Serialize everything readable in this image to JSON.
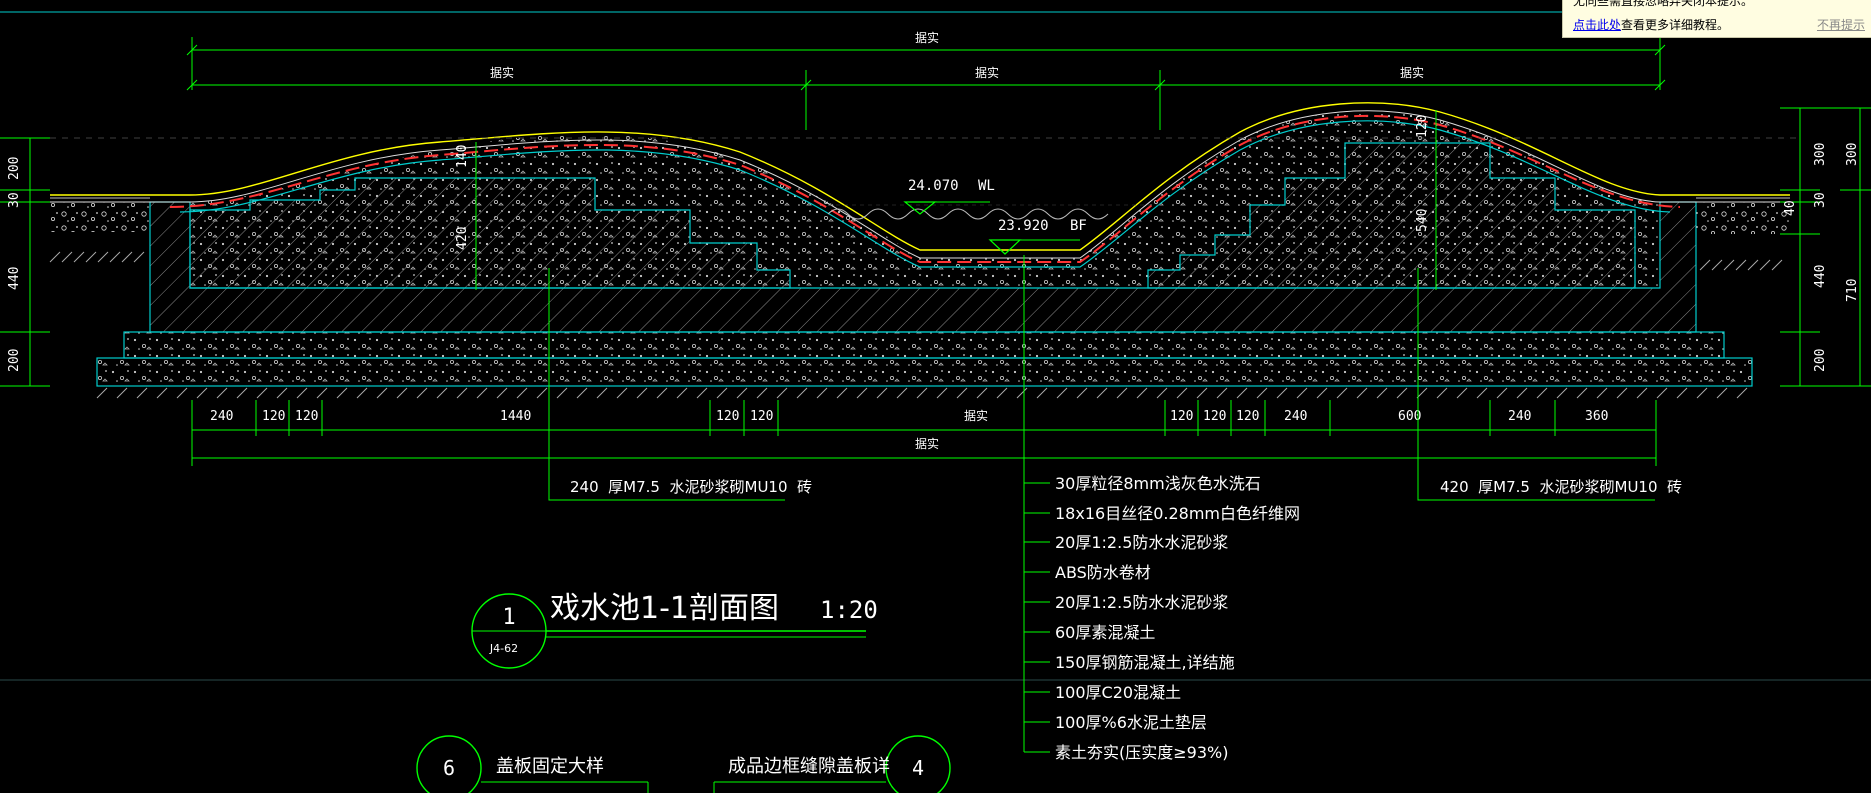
{
  "drawing": {
    "title": "戏水池1-1剖面图",
    "scale": "1:20",
    "section_number": "1",
    "sheet_ref": "J4-62",
    "top_dimension": "据实",
    "top_sub_dimensions": [
      "据实",
      "据实",
      "据实"
    ],
    "water_level": {
      "value": "24.070",
      "tag": "WL"
    },
    "bottom_level": {
      "value": "23.920",
      "tag": "BF"
    },
    "left_mound": {
      "cover": "140",
      "height": "420"
    },
    "right_mound": {
      "cover": "120",
      "height": "540"
    },
    "left_side_dims": [
      "200",
      "30",
      "440",
      "200"
    ],
    "right_side_dims_inner": [
      "300",
      "30",
      "40",
      "440",
      "200"
    ],
    "right_side_dims_outer": [
      "300",
      "710"
    ],
    "bottom_dims": [
      "240",
      "120",
      "120",
      "1440",
      "120",
      "120",
      "据实",
      "120",
      "120",
      "120",
      "240",
      "600",
      "240",
      "360"
    ],
    "bottom_total": "据实",
    "left_note": "240  厚M7.5  水泥砂浆砌MU10  砖",
    "right_note": "420  厚M7.5  水泥砂浆砌MU10  砖",
    "layers": [
      "30厚粒径8mm浅灰色水洗石",
      "18x16目丝径0.28mm白色纤维网",
      "20厚1:2.5防水水泥砂浆",
      "ABS防水卷材",
      "20厚1:2.5防水水泥砂浆",
      "60厚素混凝土",
      "150厚钢筋混凝土,详结施",
      "100厚C20混凝土",
      "100厚%6水泥土垫层",
      "素土夯实(压实度≥93%)"
    ],
    "lower_details": [
      {
        "number": "6",
        "title": "盖板固定大样"
      },
      {
        "number": "4",
        "title": "成品边框缝隙盖板详"
      }
    ]
  },
  "tooltip": {
    "line1": "无同些需直接忽略弃关闭本提示。",
    "link": "点击此处",
    "line2_rest": "查看更多详细教程。",
    "dismiss": "不再提示"
  },
  "colors": {
    "background": "#000000",
    "dimension": "#00ff00",
    "outline": "#00cccc",
    "text": "#ffffff",
    "top_layer": "#ffff00",
    "waterproof": "#ff3333",
    "tooltip_bg": "#fffde1"
  }
}
